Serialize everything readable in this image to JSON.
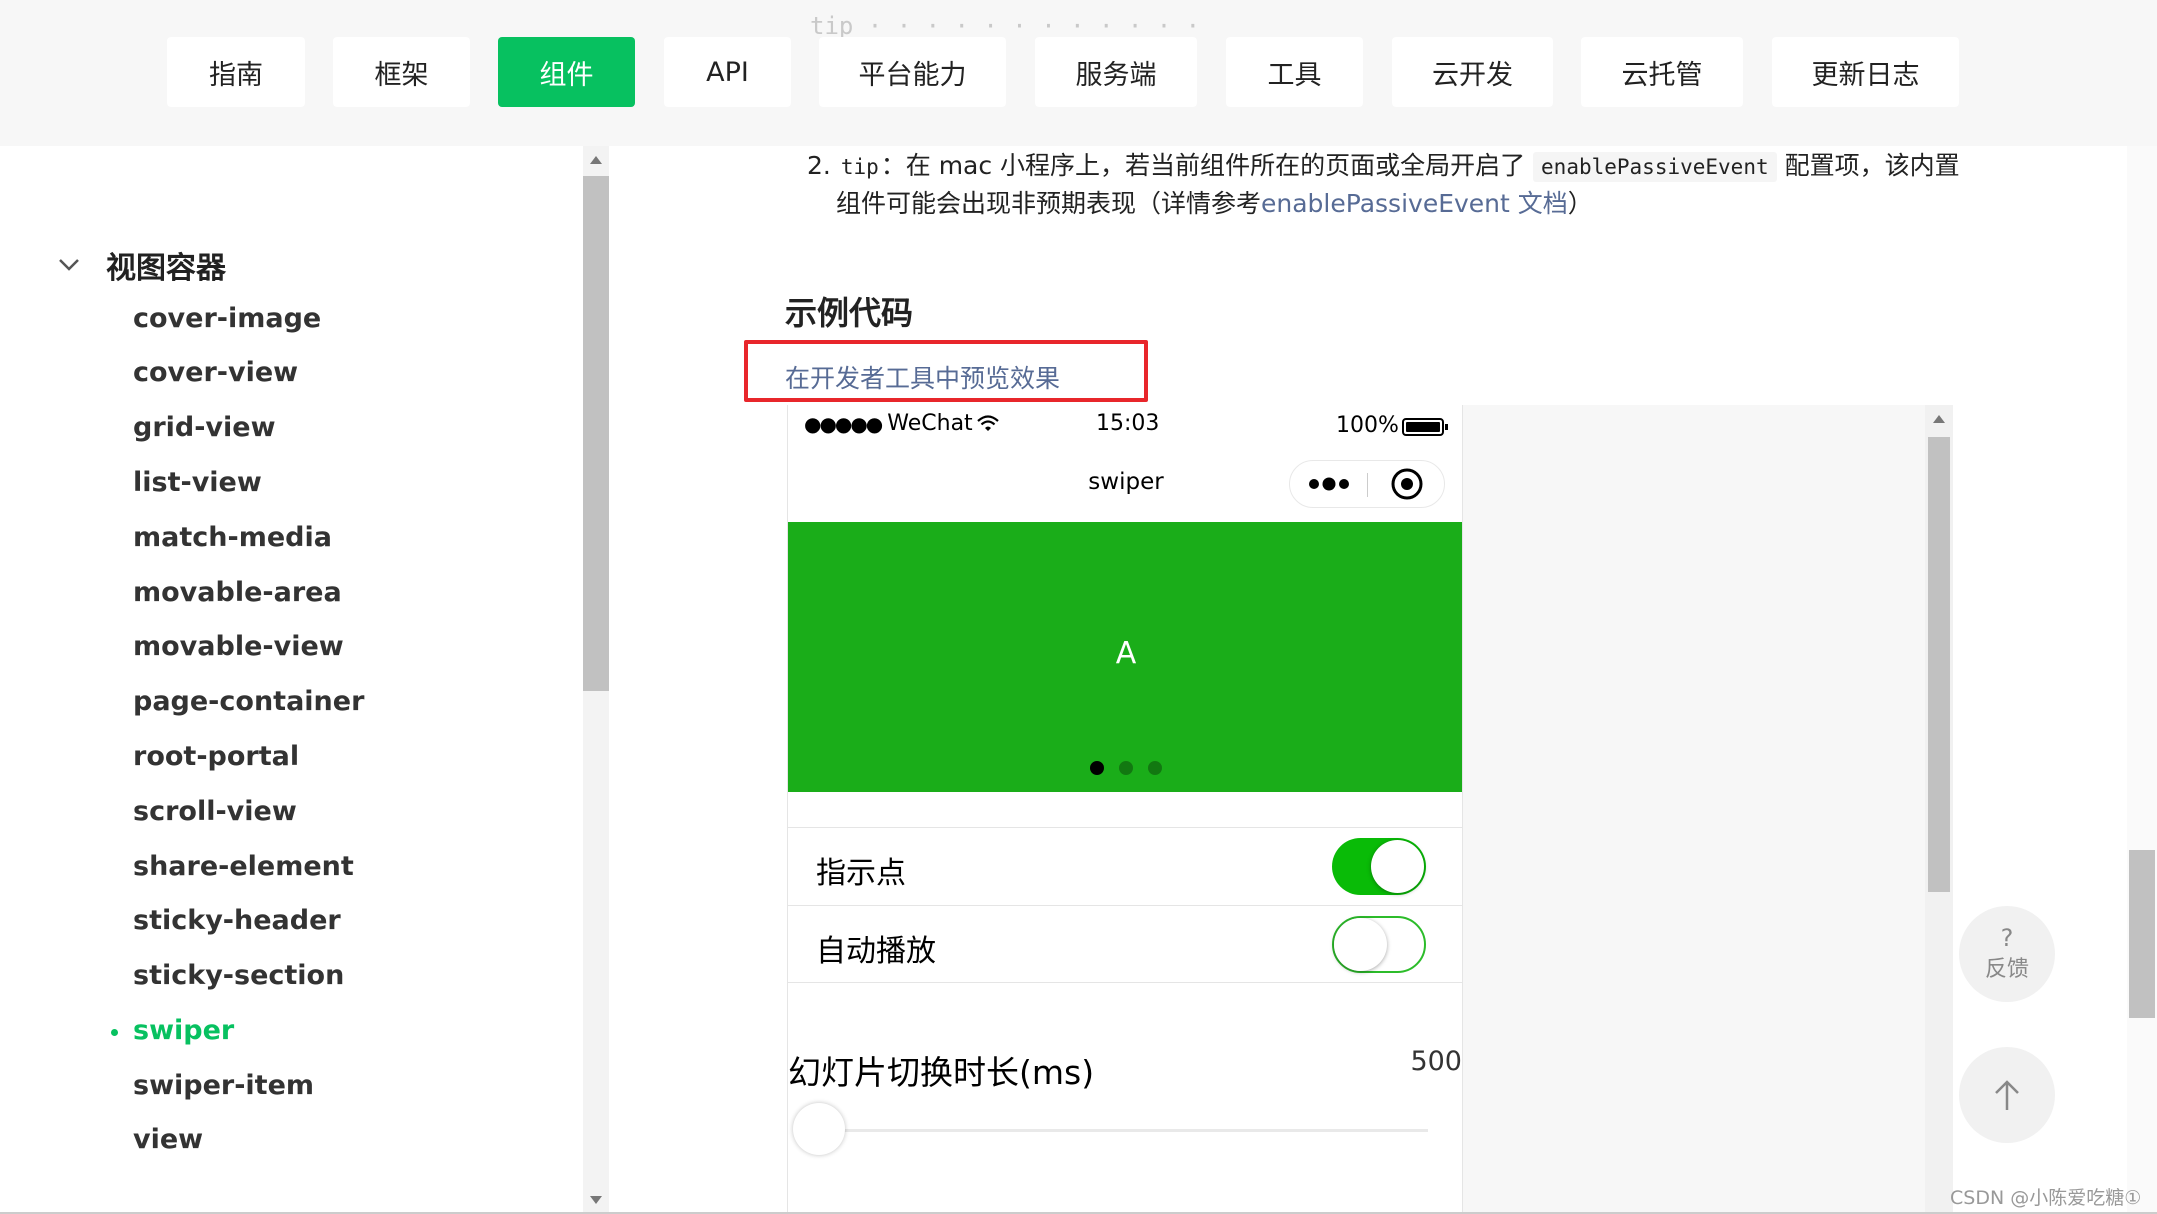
{
  "nav": {
    "items": [
      {
        "label": "指南",
        "active": false
      },
      {
        "label": "框架",
        "active": false
      },
      {
        "label": "组件",
        "active": true
      },
      {
        "label": "API",
        "active": false
      },
      {
        "label": "平台能力",
        "active": false
      },
      {
        "label": "服务端",
        "active": false
      },
      {
        "label": "工具",
        "active": false
      },
      {
        "label": "云开发",
        "active": false
      },
      {
        "label": "云托管",
        "active": false
      },
      {
        "label": "更新日志",
        "active": false
      }
    ],
    "accent": "#07c160"
  },
  "sidebar": {
    "category": "视图容器",
    "items": [
      {
        "label": "cover-image",
        "active": false
      },
      {
        "label": "cover-view",
        "active": false
      },
      {
        "label": "grid-view",
        "active": false
      },
      {
        "label": "list-view",
        "active": false
      },
      {
        "label": "match-media",
        "active": false
      },
      {
        "label": "movable-area",
        "active": false
      },
      {
        "label": "movable-view",
        "active": false
      },
      {
        "label": "page-container",
        "active": false
      },
      {
        "label": "root-portal",
        "active": false
      },
      {
        "label": "scroll-view",
        "active": false
      },
      {
        "label": "share-element",
        "active": false
      },
      {
        "label": "sticky-header",
        "active": false
      },
      {
        "label": "sticky-section",
        "active": false
      },
      {
        "label": "swiper",
        "active": true
      },
      {
        "label": "swiper-item",
        "active": false
      },
      {
        "label": "view",
        "active": false
      }
    ]
  },
  "content": {
    "tip2": {
      "number": "2.",
      "tag": "tip",
      "text_before": "：在 mac 小程序上，若当前组件所在的页面或全局开启了",
      "code": "enablePassiveEvent",
      "text_after": "配置项，该内置",
      "line2_before": "组件可能会出现非预期表现（详情参考",
      "link": "enablePassiveEvent 文档",
      "line2_after": "）"
    },
    "example_title": "示例代码",
    "preview_link": "在开发者工具中预览效果"
  },
  "phone": {
    "carrier": "WeChat",
    "time": "15:03",
    "battery": "100%",
    "title": "swiper",
    "slide_label": "A",
    "slide_color": "#1aad19",
    "dots": 3,
    "active_dot": 0,
    "switches": [
      {
        "label": "指示点",
        "on": true
      },
      {
        "label": "自动播放",
        "on": false
      }
    ],
    "slider": {
      "label": "幻灯片切换时长(ms)",
      "value": "500"
    }
  },
  "float": {
    "feedback_label": "反馈",
    "feedback_glyph": "?"
  },
  "watermark": "CSDN @小陈爱吃糖①"
}
